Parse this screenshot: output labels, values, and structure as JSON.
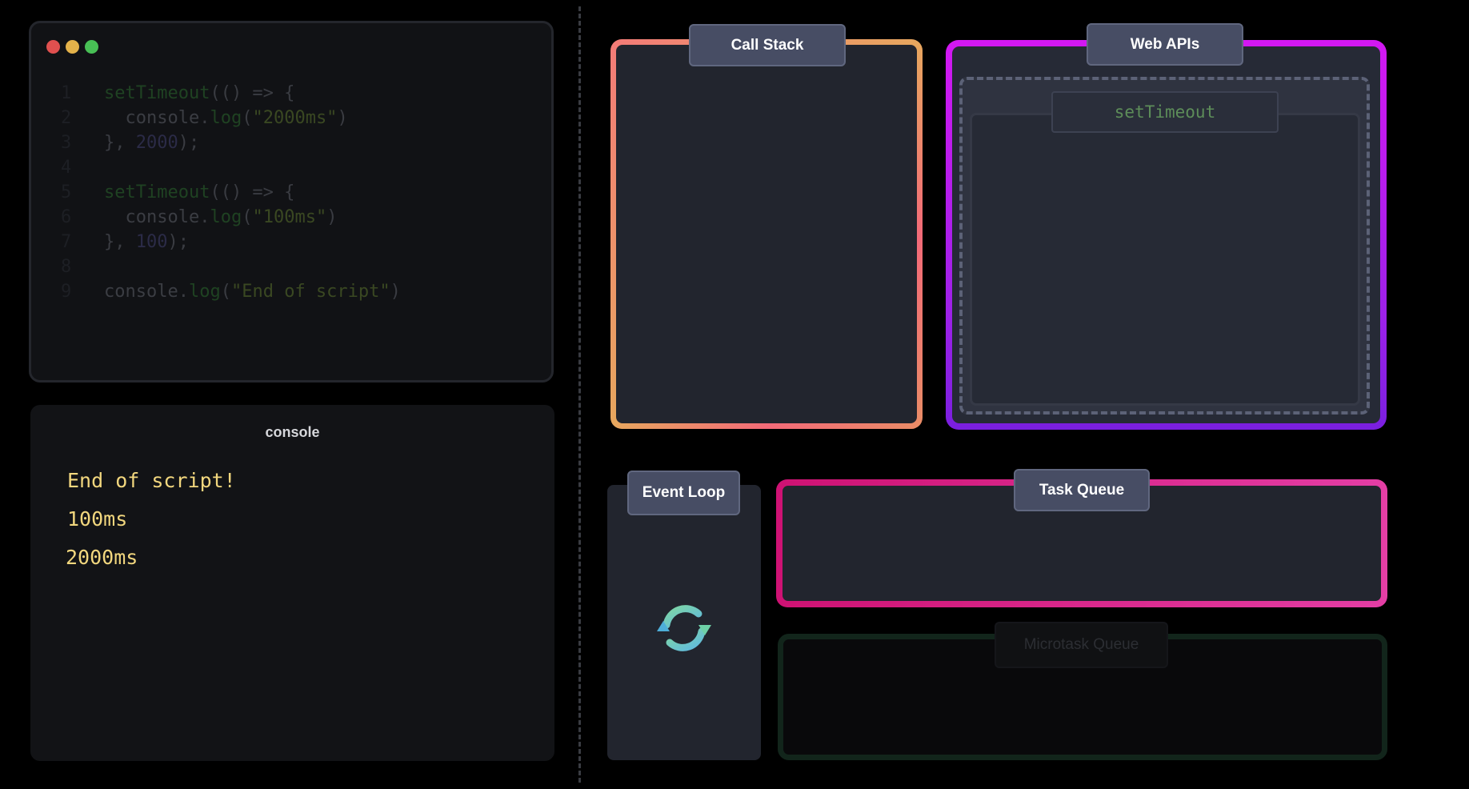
{
  "editor": {
    "lines": [
      {
        "number": "1",
        "code": "setTimeout(() => {"
      },
      {
        "number": "2",
        "code": "  console.log(\"2000ms\")"
      },
      {
        "number": "3",
        "code": "}, 2000);"
      },
      {
        "number": "4",
        "code": ""
      },
      {
        "number": "5",
        "code": "setTimeout(() => {"
      },
      {
        "number": "6",
        "code": "  console.log(\"100ms\")"
      },
      {
        "number": "7",
        "code": "}, 100);"
      },
      {
        "number": "8",
        "code": ""
      },
      {
        "number": "9",
        "code": "console.log(\"End of script\")"
      }
    ]
  },
  "console": {
    "title": "console",
    "output": [
      "End of script!",
      "100ms",
      "2000ms"
    ],
    "text_color": "#f2d77e"
  },
  "call_stack": {
    "label": "Call Stack"
  },
  "web_apis": {
    "label": "Web APIs",
    "timer": {
      "label": "setTimeout"
    }
  },
  "event_loop": {
    "label": "Event Loop",
    "icon": "refresh-icon"
  },
  "task_queue": {
    "label": "Task Queue"
  },
  "microtask_queue": {
    "label": "Microtask Queue"
  },
  "colors": {
    "call_stack_border": "#f0897a",
    "web_apis_border": "#c41cf0",
    "task_queue_border": "#dc2a8d",
    "microtask_queue_border": "#12251b",
    "tab_background": "#474d64"
  }
}
